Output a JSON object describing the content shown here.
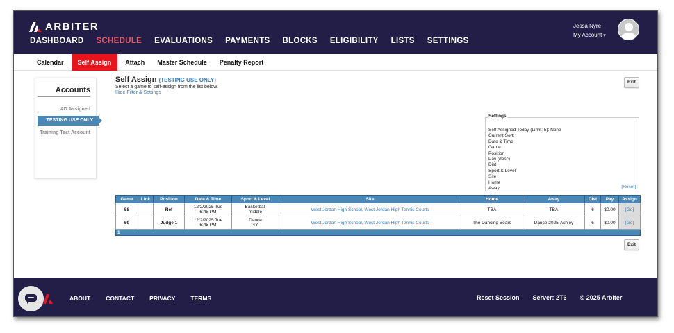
{
  "brand": {
    "name": "ARBITER"
  },
  "nav": [
    {
      "label": "DASHBOARD"
    },
    {
      "label": "SCHEDULE",
      "active": true
    },
    {
      "label": "EVALUATIONS"
    },
    {
      "label": "PAYMENTS"
    },
    {
      "label": "BLOCKS"
    },
    {
      "label": "ELIGIBILITY"
    },
    {
      "label": "LISTS"
    },
    {
      "label": "SETTINGS"
    }
  ],
  "user": {
    "name": "Jessa Nyre",
    "account_label": "My Account"
  },
  "subnav": [
    {
      "label": "Calendar"
    },
    {
      "label": "Self Assign",
      "active": true
    },
    {
      "label": "Attach"
    },
    {
      "label": "Master Schedule"
    },
    {
      "label": "Penalty Report"
    }
  ],
  "accounts": {
    "title": "Accounts",
    "items": [
      "AD Assigned",
      "TESTING USE ONLY",
      "Training Test Account"
    ]
  },
  "self_assign": {
    "title": "Self Assign",
    "tag": "(TESTING USE ONLY)",
    "subtitle": "Select a game to self-assign from the list below.",
    "toggle_link": "Hide Filter & Settings",
    "exit_label": "Exit"
  },
  "settings": {
    "legend": "Settings",
    "lines": [
      "Self Assigned Today (Limit: 5): None",
      "Current Sort:",
      "Date & Time",
      "Game",
      "Position",
      "Pay (desc)",
      "Dist",
      "Sport & Level",
      "Site",
      "Home",
      "Away"
    ],
    "reset": "[Reset]"
  },
  "table": {
    "headers": [
      "Game",
      "Link",
      "Position",
      "Date & Time",
      "Sport & Level",
      "Site",
      "Home",
      "Away",
      "Dist",
      "Pay",
      "Assign"
    ],
    "rows": [
      {
        "game": "58",
        "link": "",
        "position": "Ref",
        "date": "12/2/2025 Tue",
        "time": "6:45 PM",
        "sport": "Basketball",
        "level": "middle",
        "site": "West Jordan High School, West Jordan High Tennis Courts",
        "home": "TBA",
        "away": "TBA",
        "dist": "6",
        "pay": "$0.00",
        "assign": "[Go]"
      },
      {
        "game": "59",
        "link": "",
        "position": "Judge 1",
        "date": "12/2/2025 Tue",
        "time": "6:45 PM",
        "sport": "Dance",
        "level": "4Y",
        "site": "West Jordan High School, West Jordan High Tennis Courts",
        "home": "The Dancing Bears",
        "away": "Dance 2025-Ashley",
        "dist": "6",
        "pay": "$0.00",
        "assign": "[Go]"
      }
    ],
    "footer": "1"
  },
  "footer": {
    "links": [
      "ABOUT",
      "CONTACT",
      "PRIVACY",
      "TERMS"
    ],
    "reset_session": "Reset Session",
    "server": "Server: 2T6",
    "copyright": "© 2025 Arbiter"
  },
  "colors": {
    "navy": "#221e48",
    "accent_red": "#e8141b",
    "table_blue": "#4a88b8",
    "link_blue": "#3a7bbd"
  }
}
